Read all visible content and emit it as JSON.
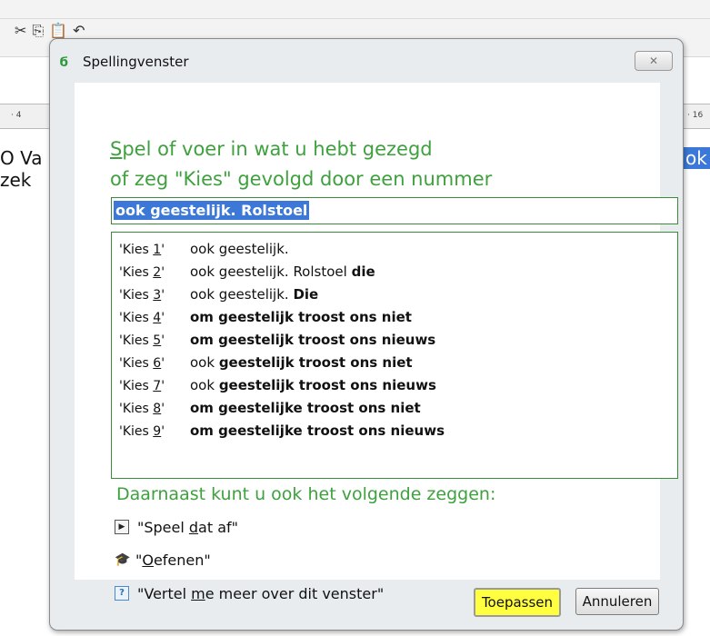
{
  "window": {
    "title": "Spellingvenster"
  },
  "background": {
    "ruler_left": "· 4",
    "ruler_right": "· 16",
    "doc_left_line1": "O Va",
    "doc_left_line2": "zek",
    "doc_right": "ok"
  },
  "dialog": {
    "instruction_line1": "Spel of voer in wat u hebt gezegd",
    "instruction_line2": "of zeg \"Kies\" gevolgd door een nummer",
    "input_value": "ook geestelijk. Rolstoel",
    "choices": [
      {
        "prefix": "'Kies ",
        "num": "1",
        "suffix": "'",
        "normal": "ook geestelijk.",
        "bold": ""
      },
      {
        "prefix": "'Kies ",
        "num": "2",
        "suffix": "'",
        "normal": "ook geestelijk. Rolstoel ",
        "bold": "die"
      },
      {
        "prefix": "'Kies ",
        "num": "3",
        "suffix": "'",
        "normal": "ook geestelijk. ",
        "bold": "Die"
      },
      {
        "prefix": "'Kies ",
        "num": "4",
        "suffix": "'",
        "normal": "",
        "bold": "om geestelijk troost ons niet"
      },
      {
        "prefix": "'Kies ",
        "num": "5",
        "suffix": "'",
        "normal": "",
        "bold": "om geestelijk troost ons nieuws"
      },
      {
        "prefix": "'Kies ",
        "num": "6",
        "suffix": "'",
        "normal": "ook ",
        "bold": "geestelijk troost ons niet"
      },
      {
        "prefix": "'Kies ",
        "num": "7",
        "suffix": "'",
        "normal": "ook ",
        "bold": "geestelijk troost ons nieuws"
      },
      {
        "prefix": "'Kies ",
        "num": "8",
        "suffix": "'",
        "normal": "",
        "bold": "om geestelijke troost ons niet"
      },
      {
        "prefix": "'Kies ",
        "num": "9",
        "suffix": "'",
        "normal": "",
        "bold": "om geestelijke troost ons nieuws"
      }
    ],
    "also_say": "Daarnaast kunt u ook het volgende zeggen:",
    "commands": [
      {
        "icon": "play-icon",
        "text": "\"Speel dat af\""
      },
      {
        "icon": "graduation-cap-icon",
        "text": "\"Oefenen\""
      },
      {
        "icon": "help-icon",
        "text": "\"Vertel me meer over dit venster\""
      }
    ],
    "apply_label": "Toepassen",
    "cancel_label": "Annuleren"
  },
  "colors": {
    "accent_green": "#3ea13e",
    "selection_blue": "#3b78d7",
    "highlight_yellow": "#ffff40"
  }
}
